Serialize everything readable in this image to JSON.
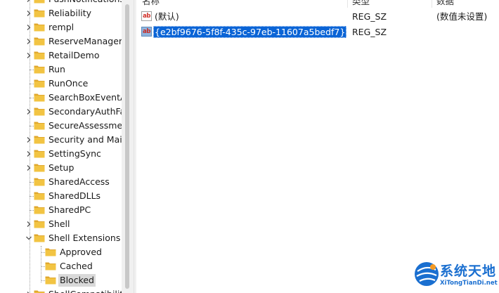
{
  "tree": {
    "items": [
      {
        "label": "PushNotifications",
        "level": 0,
        "expander": "collapsed",
        "selected": false
      },
      {
        "label": "Reliability",
        "level": 0,
        "expander": "collapsed",
        "selected": false
      },
      {
        "label": "rempl",
        "level": 0,
        "expander": "collapsed",
        "selected": false
      },
      {
        "label": "ReserveManager",
        "level": 0,
        "expander": "collapsed",
        "selected": false
      },
      {
        "label": "RetailDemo",
        "level": 0,
        "expander": "collapsed",
        "selected": false
      },
      {
        "label": "Run",
        "level": 0,
        "expander": "none",
        "selected": false
      },
      {
        "label": "RunOnce",
        "level": 0,
        "expander": "none",
        "selected": false
      },
      {
        "label": "SearchBoxEventArgsProvider",
        "level": 0,
        "expander": "none",
        "selected": false
      },
      {
        "label": "SecondaryAuthFactor",
        "level": 0,
        "expander": "collapsed",
        "selected": false
      },
      {
        "label": "SecureAssessment",
        "level": 0,
        "expander": "none",
        "selected": false
      },
      {
        "label": "Security and Maintenance",
        "level": 0,
        "expander": "collapsed",
        "selected": false
      },
      {
        "label": "SettingSync",
        "level": 0,
        "expander": "collapsed",
        "selected": false
      },
      {
        "label": "Setup",
        "level": 0,
        "expander": "collapsed",
        "selected": false
      },
      {
        "label": "SharedAccess",
        "level": 0,
        "expander": "none",
        "selected": false
      },
      {
        "label": "SharedDLLs",
        "level": 0,
        "expander": "none",
        "selected": false
      },
      {
        "label": "SharedPC",
        "level": 0,
        "expander": "none",
        "selected": false
      },
      {
        "label": "Shell",
        "level": 0,
        "expander": "collapsed",
        "selected": false
      },
      {
        "label": "Shell Extensions",
        "level": 0,
        "expander": "expanded",
        "selected": false
      },
      {
        "label": "Approved",
        "level": 1,
        "expander": "none",
        "selected": false
      },
      {
        "label": "Cached",
        "level": 1,
        "expander": "none",
        "selected": false
      },
      {
        "label": "Blocked",
        "level": 1,
        "expander": "none",
        "selected": true
      },
      {
        "label": "ShellCompatibility",
        "level": 0,
        "expander": "collapsed",
        "selected": false
      }
    ]
  },
  "values": {
    "columns": {
      "name": "名称",
      "type": "类型",
      "data": "数据"
    },
    "rows": [
      {
        "name": "(默认)",
        "type": "REG_SZ",
        "data": "(数值未设置)",
        "selected": false
      },
      {
        "name": "{e2bf9676-5f8f-435c-97eb-11607a5bedf7}",
        "type": "REG_SZ",
        "data": "",
        "selected": true
      }
    ]
  },
  "icons": {
    "string_value": "ab",
    "folder": "folder-icon",
    "expand": "chevron-right-icon",
    "collapse": "chevron-down-icon"
  },
  "watermark": {
    "title": "系统天地",
    "subtitle": "XiTongTianDi.net"
  },
  "colors": {
    "selection": "#0a64d6",
    "folder": "#f2c443",
    "tree_selected": "#d9d9d9",
    "watermark": "#1a6fd0"
  }
}
